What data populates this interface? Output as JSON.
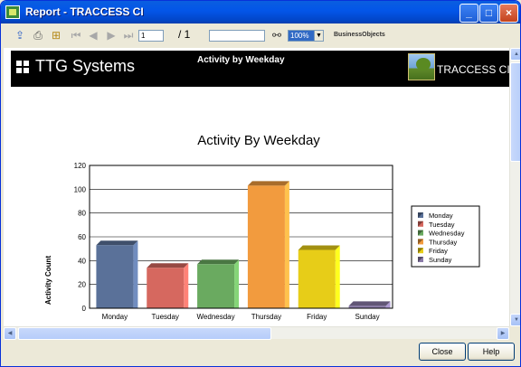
{
  "window": {
    "title": "Report - TRACCESS CI"
  },
  "toolbar": {
    "page_current": "1",
    "page_total": "/ 1",
    "search_value": "",
    "zoom_value": "100%",
    "brand": "BusinessObjects"
  },
  "report": {
    "company_name": "TTG Systems",
    "header_title": "Activity by Weekday",
    "product_name": "TRACCESS CI"
  },
  "chart_data": {
    "type": "bar",
    "title": "Activity By Weekday",
    "ylabel": "Activity Count",
    "xlabel": "",
    "categories": [
      "Monday",
      "Tuesday",
      "Wednesday",
      "Thursday",
      "Friday",
      "Sunday"
    ],
    "values": [
      53,
      34,
      37,
      103,
      49,
      2
    ],
    "colors": [
      "#5a7199",
      "#d6685f",
      "#6aaa60",
      "#f29b3e",
      "#e7cd18",
      "#8a7ba8"
    ],
    "ylim": [
      0,
      120
    ],
    "yticks": [
      "0",
      "20",
      "40",
      "60",
      "80",
      "100",
      "120"
    ],
    "grid": true,
    "legend_position": "right",
    "legend": [
      "Monday",
      "Tuesday",
      "Wednesday",
      "Thursday",
      "Friday",
      "Sunday"
    ]
  },
  "buttons": {
    "close": "Close",
    "help": "Help"
  },
  "icons": [
    "export-icon",
    "print-icon",
    "tree-icon",
    "first-page-icon",
    "prev-page-icon",
    "next-page-icon",
    "last-page-icon",
    "binoculars-icon"
  ]
}
